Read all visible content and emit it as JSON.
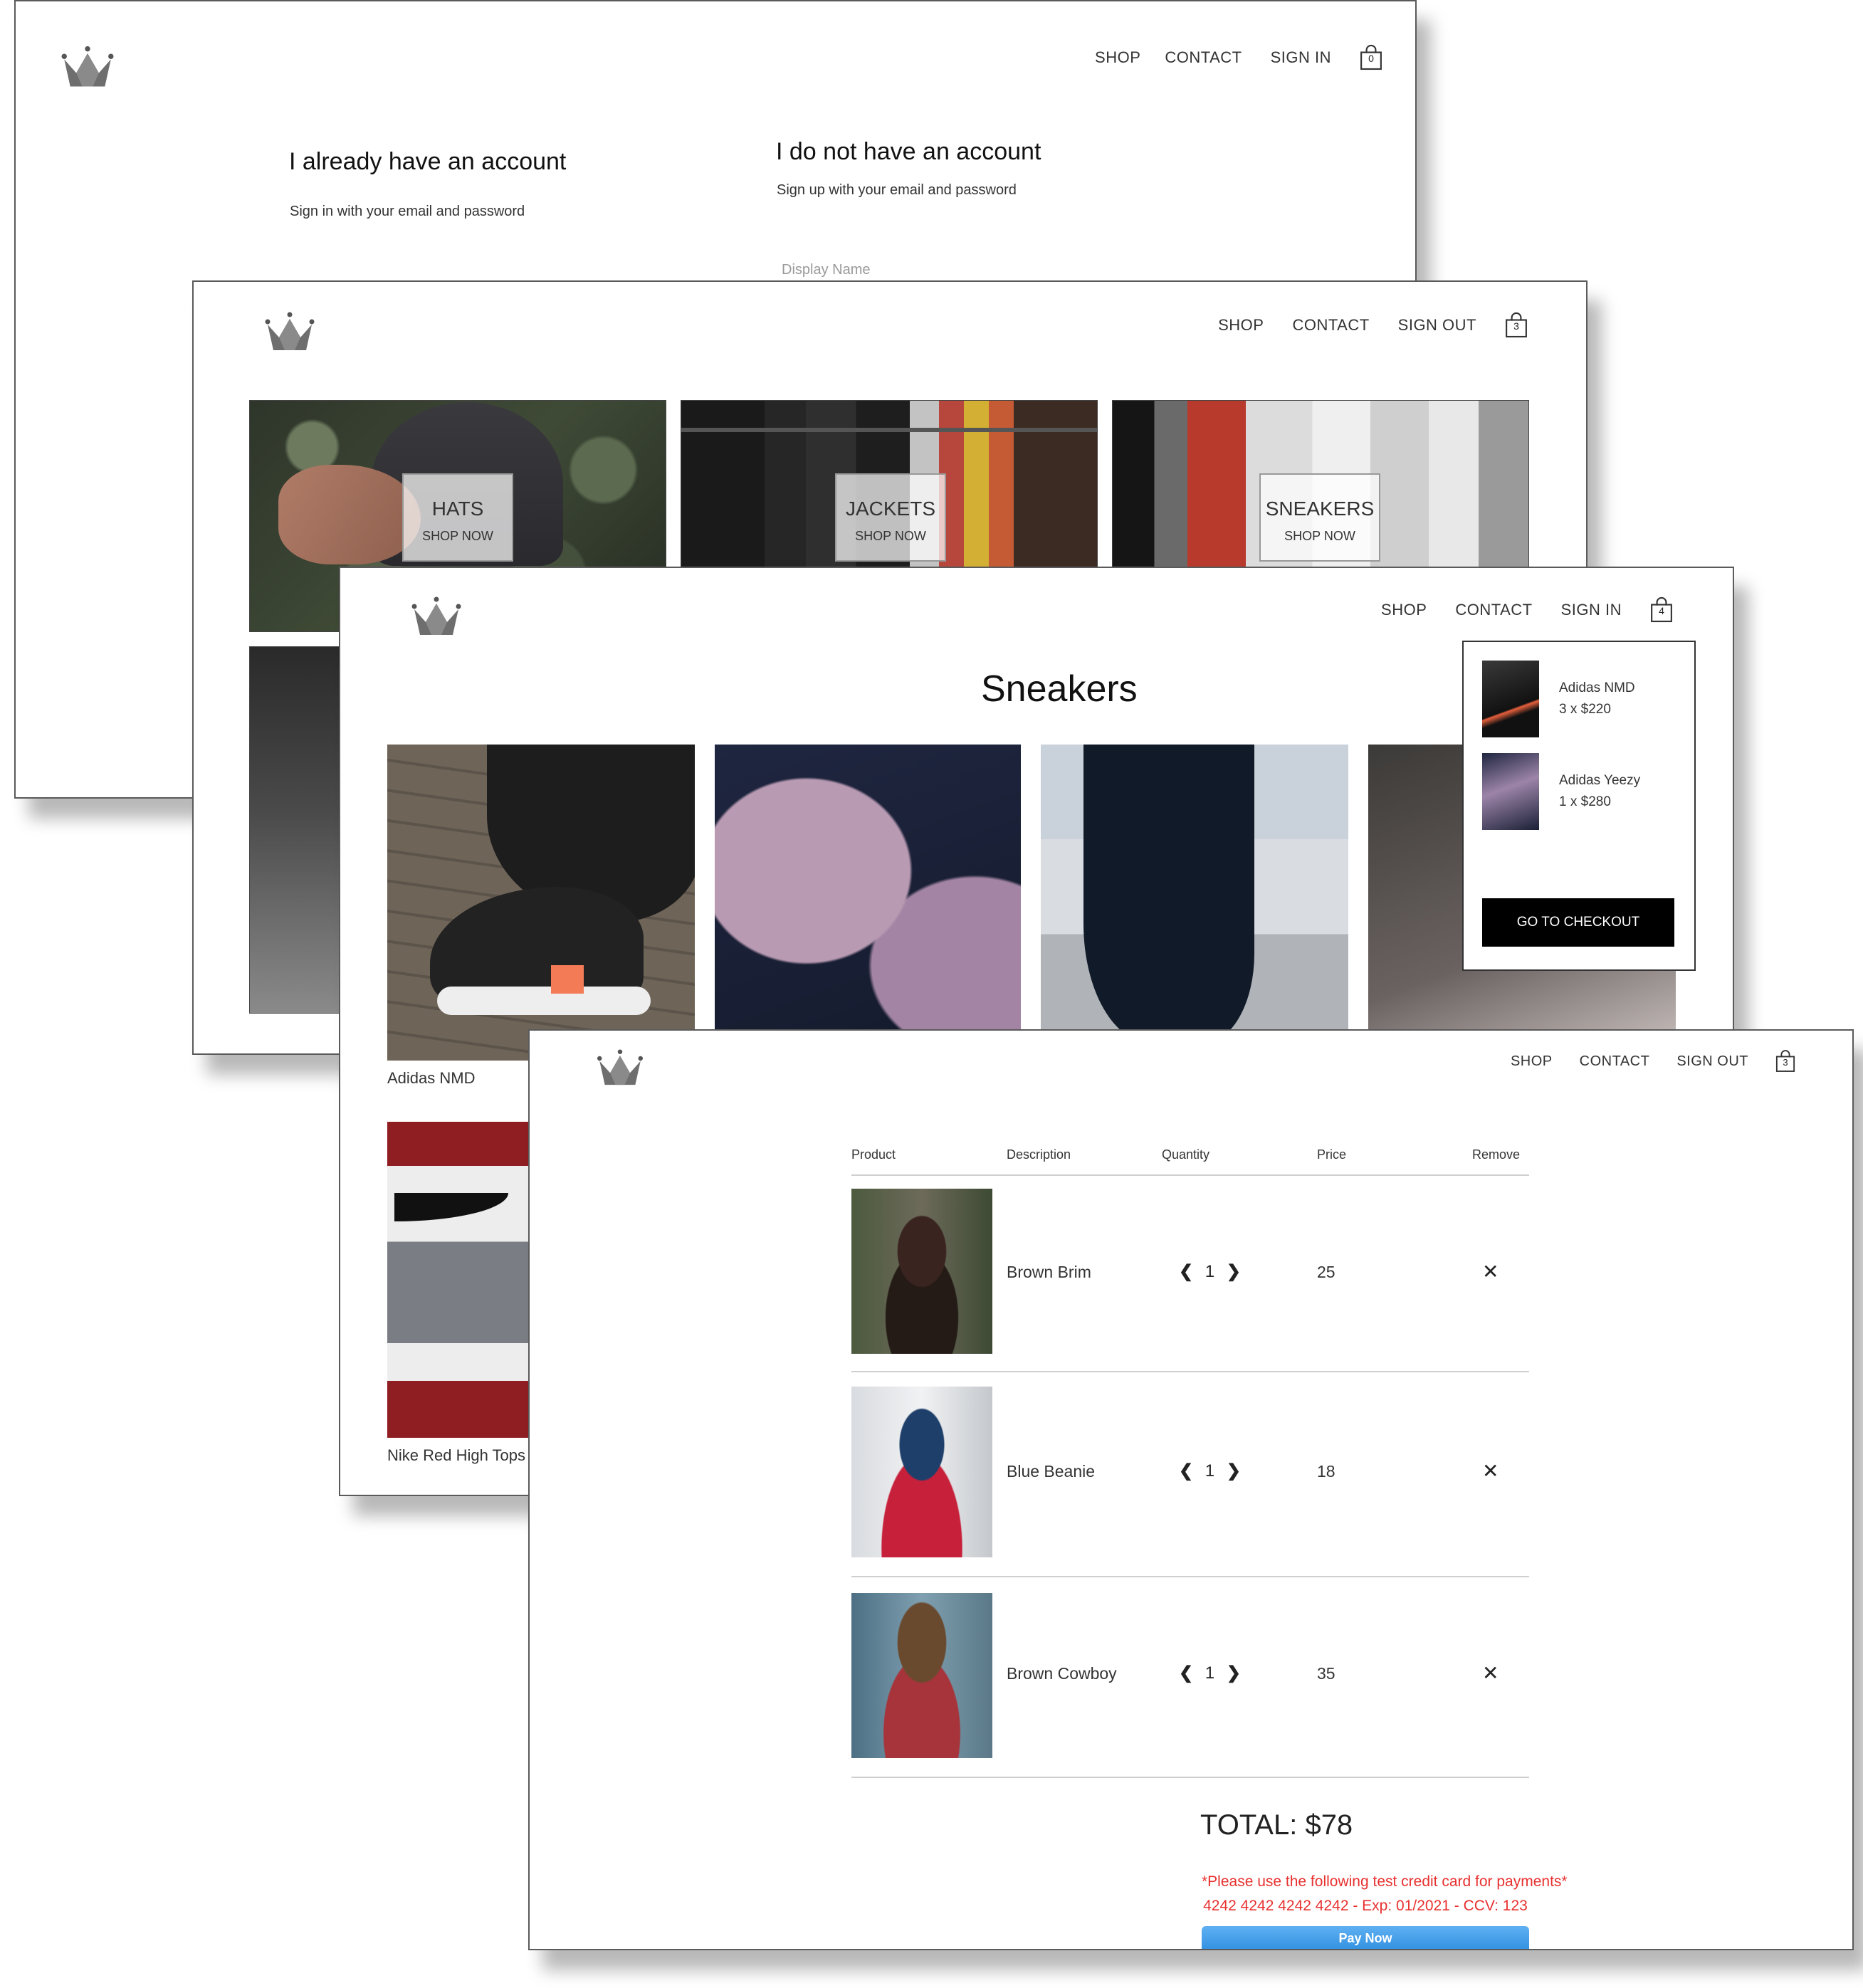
{
  "nav": {
    "shop": "SHOP",
    "contact": "CONTACT",
    "sign_in": "SIGN IN",
    "sign_out": "SIGN OUT"
  },
  "screen_signin": {
    "cart_count": "0",
    "have_account_title": "I already have an account",
    "have_account_subtitle": "Sign in with your email and password",
    "no_account_title": "I do not have an account",
    "no_account_subtitle": "Sign up with your email and password",
    "display_name_placeholder": "Display Name"
  },
  "screen_home": {
    "cart_count": "3",
    "categories": [
      {
        "title": "HATS",
        "cta": "SHOP NOW"
      },
      {
        "title": "JACKETS",
        "cta": "SHOP NOW"
      },
      {
        "title": "SNEAKERS",
        "cta": "SHOP NOW"
      }
    ]
  },
  "screen_collection": {
    "cart_count": "4",
    "title": "Sneakers",
    "products": [
      {
        "name": "Adidas NMD"
      },
      {
        "name": "Nike Red High Tops"
      }
    ],
    "cart_dropdown": {
      "items": [
        {
          "name": "Adidas NMD",
          "qty_price": "3 x $220"
        },
        {
          "name": "Adidas Yeezy",
          "qty_price": "1 x $280"
        }
      ],
      "checkout_label": "GO TO CHECKOUT"
    }
  },
  "screen_checkout": {
    "cart_count": "3",
    "headers": {
      "product": "Product",
      "description": "Description",
      "quantity": "Quantity",
      "price": "Price",
      "remove": "Remove"
    },
    "items": [
      {
        "description": "Brown Brim",
        "quantity": "1",
        "price": "25"
      },
      {
        "description": "Blue Beanie",
        "quantity": "1",
        "price": "18"
      },
      {
        "description": "Brown Cowboy",
        "quantity": "1",
        "price": "35"
      }
    ],
    "total": "TOTAL: $78",
    "test_card_note": "*Please use the following test credit card for payments*",
    "test_card_details": "4242 4242 4242 4242 - Exp: 01/2021 - CCV: 123",
    "pay_label": "Pay Now"
  },
  "colors": {
    "accent_red": "#e8312f",
    "pay_blue": "#2f8fe0",
    "checkout_black": "#000000"
  },
  "icons": {
    "logo": "crown-icon",
    "cart": "shopping-bag-icon",
    "remove": "close-icon",
    "qty_dec": "chevron-left-icon",
    "qty_inc": "chevron-right-icon"
  }
}
